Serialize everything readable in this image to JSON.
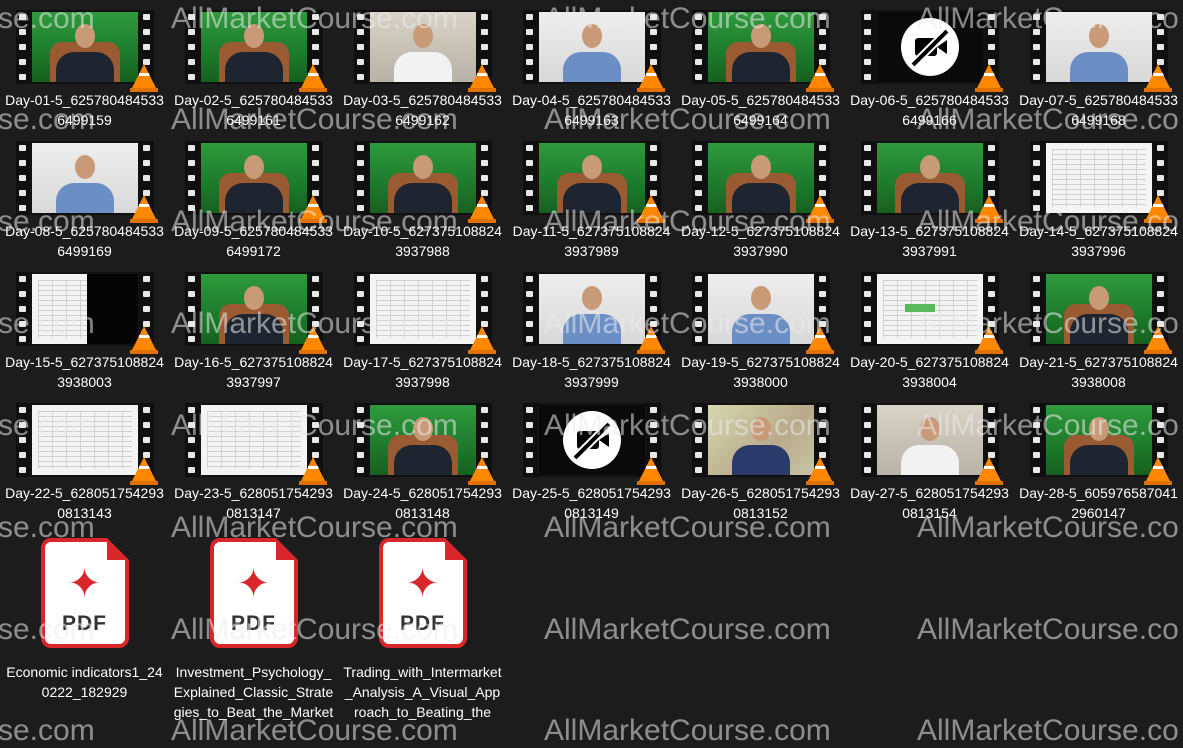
{
  "watermark_text": "AllMarketCourse.com",
  "watermark_left_fragment": "se.com",
  "watermark_right_fragment": "AllMarketCourse.co",
  "videos": [
    {
      "name": "Day-01-5_6257804845336499159",
      "thumb": "green",
      "icon": "vlc-cone-icon"
    },
    {
      "name": "Day-02-5_6257804845336499161",
      "thumb": "green",
      "icon": "vlc-cone-icon"
    },
    {
      "name": "Day-03-5_6257804845336499162",
      "thumb": "room",
      "icon": "vlc-cone-icon"
    },
    {
      "name": "Day-04-5_6257804845336499163",
      "thumb": "light",
      "icon": "vlc-cone-icon"
    },
    {
      "name": "Day-05-5_6257804845336499164",
      "thumb": "green",
      "icon": "vlc-cone-icon"
    },
    {
      "name": "Day-06-5_6257804845336499166",
      "thumb": "novideo",
      "icon": "vlc-cone-icon"
    },
    {
      "name": "Day-07-5_6257804845336499168",
      "thumb": "light",
      "icon": "vlc-cone-icon"
    },
    {
      "name": "Day-08-5_6257804845336499169",
      "thumb": "light",
      "icon": "vlc-cone-icon"
    },
    {
      "name": "Day-09-5_6257804845336499172",
      "thumb": "green",
      "icon": "vlc-cone-icon"
    },
    {
      "name": "Day-10-5_6273751088243937988",
      "thumb": "green",
      "icon": "vlc-cone-icon"
    },
    {
      "name": "Day-11-5_6273751088243937989",
      "thumb": "green",
      "icon": "vlc-cone-icon"
    },
    {
      "name": "Day-12-5_6273751088243937990",
      "thumb": "green",
      "icon": "vlc-cone-icon"
    },
    {
      "name": "Day-13-5_6273751088243937991",
      "thumb": "green",
      "icon": "vlc-cone-icon"
    },
    {
      "name": "Day-14-5_6273751088243937996",
      "thumb": "sheet",
      "icon": "vlc-cone-icon"
    },
    {
      "name": "Day-15-5_6273751088243938003",
      "thumb": "sheetdark",
      "icon": "vlc-cone-icon"
    },
    {
      "name": "Day-16-5_6273751088243937997",
      "thumb": "green",
      "icon": "vlc-cone-icon"
    },
    {
      "name": "Day-17-5_6273751088243937998",
      "thumb": "sheet",
      "icon": "vlc-cone-icon"
    },
    {
      "name": "Day-18-5_6273751088243937999",
      "thumb": "light",
      "icon": "vlc-cone-icon"
    },
    {
      "name": "Day-19-5_6273751088243938000",
      "thumb": "light",
      "icon": "vlc-cone-icon"
    },
    {
      "name": "Day-20-5_6273751088243938004",
      "thumb": "sheetgreen",
      "icon": "vlc-cone-icon"
    },
    {
      "name": "Day-21-5_6273751088243938008",
      "thumb": "green",
      "icon": "vlc-cone-icon"
    },
    {
      "name": "Day-22-5_6280517542930813143",
      "thumb": "sheet",
      "icon": "vlc-cone-icon"
    },
    {
      "name": "Day-23-5_6280517542930813147",
      "thumb": "sheet",
      "icon": "vlc-cone-icon"
    },
    {
      "name": "Day-24-5_6280517542930813148",
      "thumb": "green",
      "icon": "vlc-cone-icon"
    },
    {
      "name": "Day-25-5_6280517542930813149",
      "thumb": "novideo",
      "icon": "vlc-cone-icon"
    },
    {
      "name": "Day-26-5_6280517542930813152",
      "thumb": "blur",
      "icon": "vlc-cone-icon"
    },
    {
      "name": "Day-27-5_6280517542930813154",
      "thumb": "room",
      "icon": "vlc-cone-icon"
    },
    {
      "name": "Day-28-5_6059765870412960147",
      "thumb": "green",
      "icon": "vlc-cone-icon"
    }
  ],
  "pdfs": [
    {
      "name": "Economic indicators1_240222_182929",
      "badge": "PDF",
      "icon": "pdf-file-icon"
    },
    {
      "name": "Investment_Psychology_Explained_Classic_Strategies_to_Beat_the_Markets",
      "badge": "PDF",
      "icon": "pdf-file-icon"
    },
    {
      "name": "Trading_with_Intermarket_Analysis_A_Visual_Approach_to_Beating_the",
      "badge": "PDF",
      "icon": "pdf-file-icon"
    }
  ]
}
